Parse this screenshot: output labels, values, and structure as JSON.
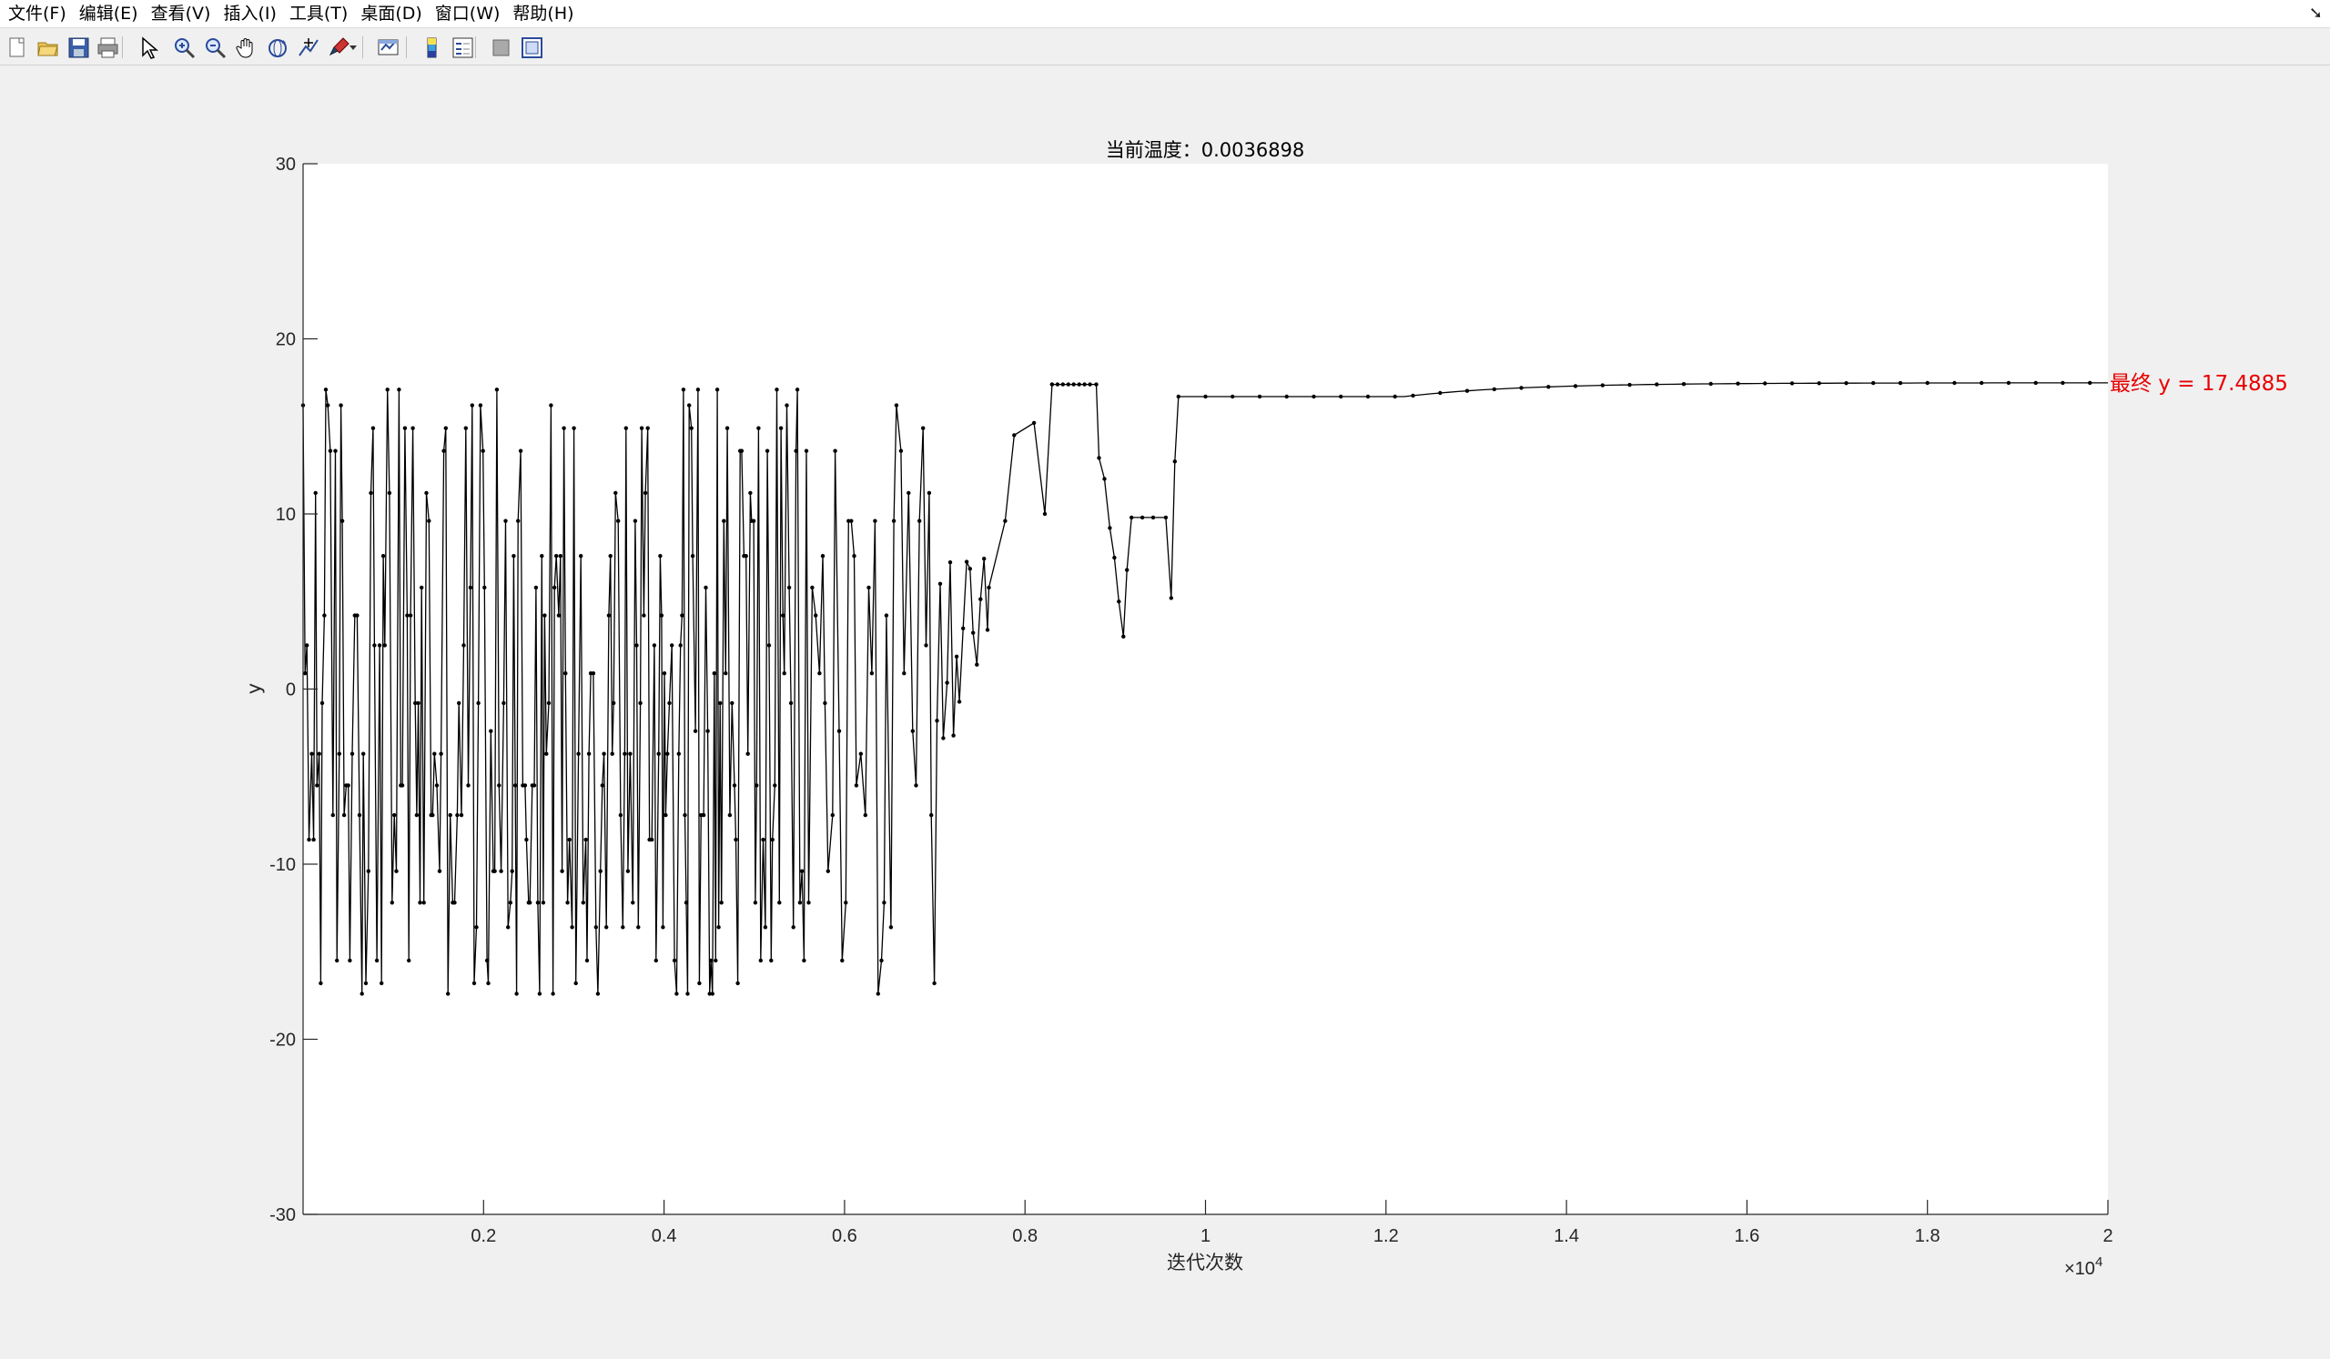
{
  "menubar": {
    "items": [
      "文件(F)",
      "编辑(E)",
      "查看(V)",
      "插入(I)",
      "工具(T)",
      "桌面(D)",
      "窗口(W)",
      "帮助(H)"
    ]
  },
  "toolbar": {
    "buttons": [
      {
        "name": "new-figure-icon"
      },
      {
        "name": "open-file-icon"
      },
      {
        "name": "save-icon"
      },
      {
        "name": "print-icon"
      },
      {
        "name": "select-arrow-icon"
      },
      {
        "name": "zoom-in-icon"
      },
      {
        "name": "zoom-out-icon"
      },
      {
        "name": "pan-hand-icon"
      },
      {
        "name": "rotate-3d-icon"
      },
      {
        "name": "data-cursor-icon"
      },
      {
        "name": "brush-icon"
      },
      {
        "name": "link-plot-icon"
      },
      {
        "name": "colorbar-icon"
      },
      {
        "name": "legend-icon"
      },
      {
        "name": "hide-plot-tools-icon"
      },
      {
        "name": "show-plot-tools-icon"
      }
    ]
  },
  "chart_data": {
    "type": "line",
    "title": "当前温度：0.0036898",
    "xlabel": "迭代次数",
    "ylabel": "y",
    "xlim": [
      0,
      20000
    ],
    "ylim": [
      -30,
      30
    ],
    "x_ticks": [
      2000,
      4000,
      6000,
      8000,
      10000,
      12000,
      14000,
      16000,
      18000,
      20000
    ],
    "x_tick_labels": [
      "0.2",
      "0.4",
      "0.6",
      "0.8",
      "1",
      "1.2",
      "1.4",
      "1.6",
      "1.8",
      "2"
    ],
    "x_exponent_label": "×10",
    "x_exponent_power": "4",
    "y_ticks": [
      -30,
      -20,
      -10,
      0,
      10,
      20,
      30
    ],
    "y_tick_labels": [
      "-30",
      "-20",
      "-10",
      "0",
      "10",
      "20",
      "30"
    ],
    "grid": false,
    "marker": "dot",
    "line_color": "#000000",
    "annotation": {
      "text": "最终 y = 17.4885",
      "x": 20000,
      "y": 17.4885,
      "color": "#e80000"
    },
    "series": [
      {
        "segments": [
          {
            "x_start": 0,
            "x_end": 5600,
            "behavior": "dense random oscillation",
            "y_min": -17.5,
            "y_max": 17.4
          },
          {
            "x_start": 5600,
            "x_end": 7000,
            "behavior": "sparser oscillation",
            "y_min": -17.5,
            "y_max": 17.0
          },
          {
            "x_start": 7000,
            "x_end": 7600,
            "behavior": "stepwise",
            "y_min": -4.0,
            "y_max": 7.5
          },
          {
            "x_start": 7600,
            "x_end": 8300,
            "behavior": "plateaus",
            "values": [
              5.8,
              9.6,
              14.5,
              15.2
            ]
          },
          {
            "x_start": 8300,
            "x_end": 8800,
            "behavior": "plateau",
            "values": [
              17.4
            ]
          },
          {
            "x_start": 8800,
            "x_end": 9700,
            "behavior": "descending then rising",
            "y_min": 2.5,
            "y_max": 13.0
          },
          {
            "x_start": 9700,
            "x_end": 12200,
            "behavior": "plateau",
            "values": [
              16.7
            ]
          },
          {
            "x_start": 12200,
            "x_end": 20000,
            "behavior": "slow rise to final",
            "y_min": 16.7,
            "y_max": 17.4885
          }
        ]
      }
    ]
  }
}
